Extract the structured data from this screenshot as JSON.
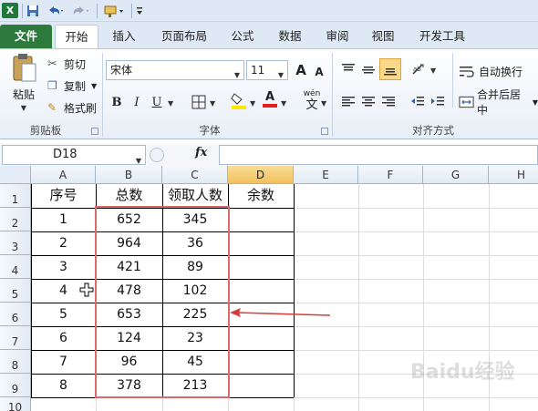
{
  "qat": {
    "logo": "X",
    "save_icon": "save-icon",
    "undo_icon": "undo-icon",
    "redo_icon": "redo-icon",
    "custom_icon": "format-painter-icon",
    "more_icon": "customize-icon"
  },
  "tabs": [
    {
      "label": "文件"
    },
    {
      "label": "开始"
    },
    {
      "label": "插入"
    },
    {
      "label": "页面布局"
    },
    {
      "label": "公式"
    },
    {
      "label": "数据"
    },
    {
      "label": "审阅"
    },
    {
      "label": "视图"
    },
    {
      "label": "开发工具"
    }
  ],
  "ribbon": {
    "clipboard": {
      "paste": "粘贴",
      "cut": "剪切",
      "copy": "复制",
      "format_painter": "格式刷",
      "label": "剪贴板"
    },
    "font": {
      "name": "宋体",
      "size": "11",
      "grow": "A",
      "shrink": "A",
      "bold": "B",
      "italic": "I",
      "underline": "U",
      "font_color": "A",
      "phonetic_top": "wén",
      "phonetic_bottom": "文",
      "label": "字体"
    },
    "alignment": {
      "wrap": "自动换行",
      "merge": "合并后居中",
      "label": "对齐方式"
    }
  },
  "formula_bar": {
    "name_box": "D18",
    "fx": "fx",
    "content": ""
  },
  "columns": [
    "A",
    "B",
    "C",
    "D",
    "E",
    "F",
    "G",
    "H"
  ],
  "rows": [
    "1",
    "2",
    "3",
    "4",
    "5",
    "6",
    "7",
    "8",
    "9",
    "10"
  ],
  "sheet": {
    "headers": [
      "序号",
      "总数",
      "领取人数",
      "余数"
    ],
    "data": [
      [
        "1",
        "652",
        "345"
      ],
      [
        "2",
        "964",
        "36"
      ],
      [
        "3",
        "421",
        "89"
      ],
      [
        "4",
        "478",
        "102"
      ],
      [
        "5",
        "653",
        "225"
      ],
      [
        "6",
        "124",
        "23"
      ],
      [
        "7",
        "96",
        "45"
      ],
      [
        "8",
        "378",
        "213"
      ]
    ]
  },
  "watermark": "Baidu经验",
  "colors": {
    "file_tab": "#2d7a3c",
    "selected_col": "#f1c15f",
    "annotation": "#d63c3c",
    "grid": "#dadcdd"
  }
}
